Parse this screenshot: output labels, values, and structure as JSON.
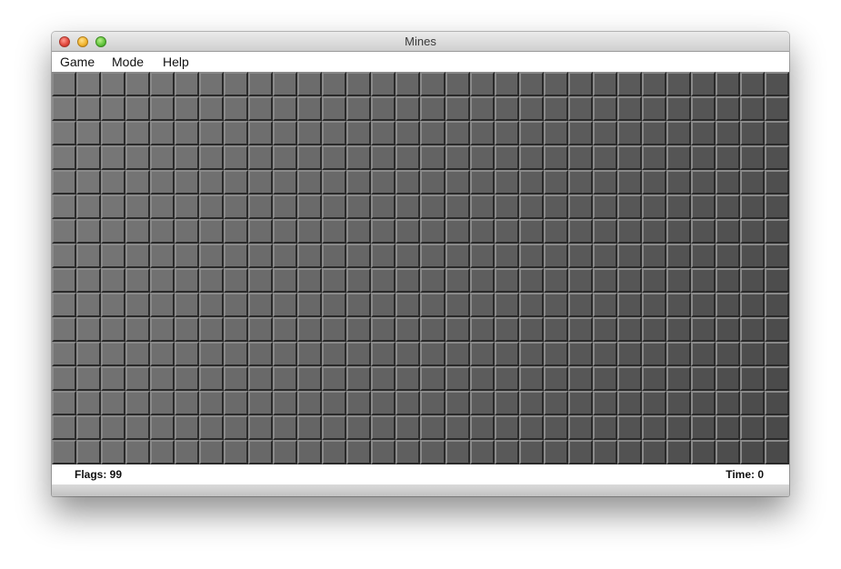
{
  "window": {
    "title": "Mines"
  },
  "menu": {
    "items": [
      "Game",
      "Mode",
      "Help"
    ]
  },
  "board": {
    "columns": 30,
    "rows": 16,
    "tile_state": "unrevealed",
    "tile_color_light": "#7a7a7a",
    "tile_color_dark": "#4a4a4a"
  },
  "status": {
    "flags_label": "Flags: 99",
    "time_label": "Time: 0"
  },
  "colors": {
    "close": "#e0443a",
    "minimize": "#f1b32b",
    "zoom": "#5fc23a"
  }
}
